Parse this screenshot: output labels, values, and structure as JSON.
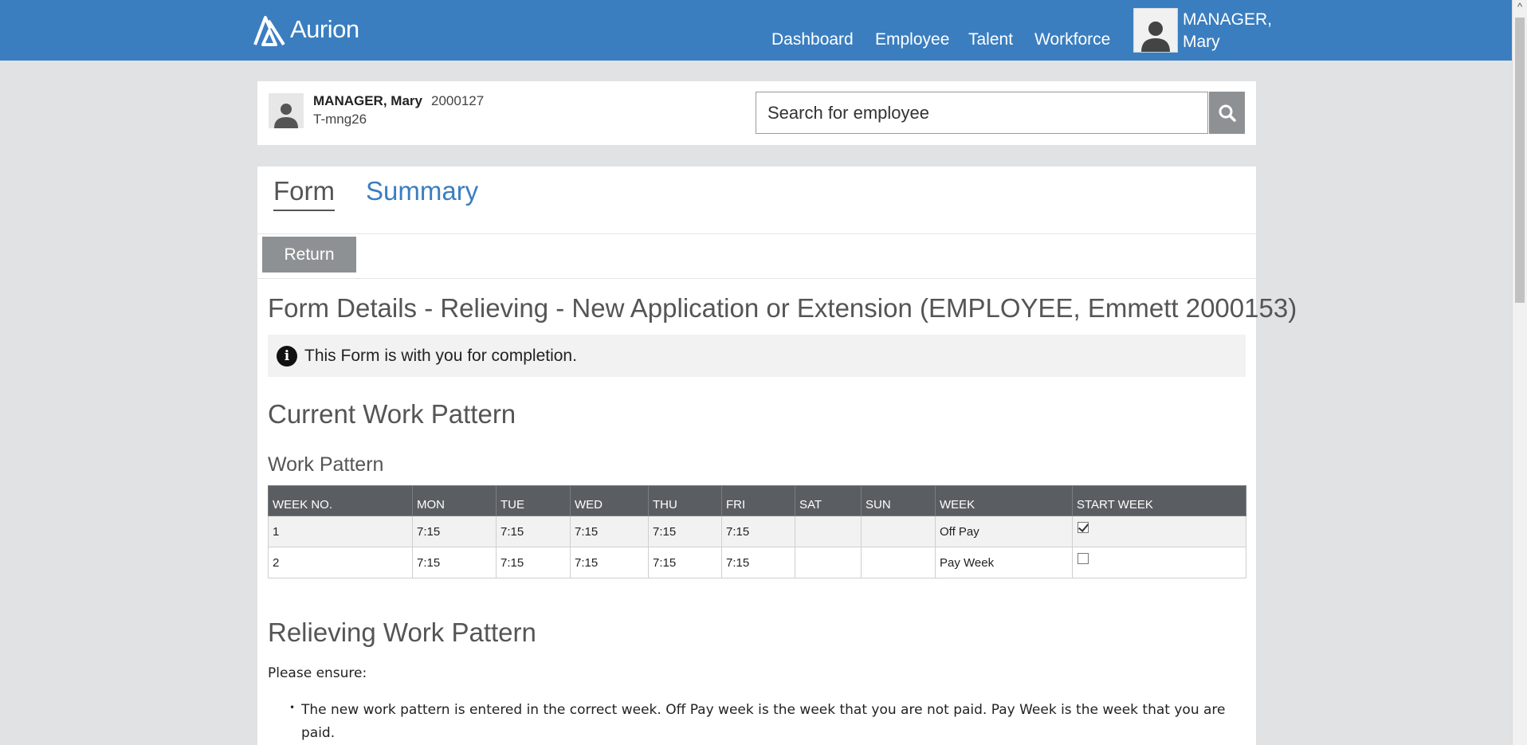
{
  "app": {
    "brand": "Aurion",
    "nav": [
      "Dashboard",
      "Employee",
      "Talent",
      "Workforce"
    ],
    "user": {
      "line1": "MANAGER,",
      "line2": "Mary"
    }
  },
  "employee": {
    "name": "MANAGER, Mary",
    "id": "2000127",
    "code": "T-mng26"
  },
  "search": {
    "placeholder": "Search for employee",
    "icon": "search-icon"
  },
  "tabs": [
    {
      "label": "Form",
      "active": true
    },
    {
      "label": "Summary",
      "active": false
    }
  ],
  "toolbar": {
    "return_label": "Return"
  },
  "form": {
    "title": "Form Details - Relieving - New Application or Extension (EMPLOYEE, Emmett 2000153)",
    "info": "This Form is with you for completion."
  },
  "current": {
    "heading": "Current Work Pattern",
    "subheading": "Work Pattern",
    "columns": [
      "WEEK NO.",
      "MON",
      "TUE",
      "WED",
      "THU",
      "FRI",
      "SAT",
      "SUN",
      "WEEK",
      "START WEEK"
    ],
    "rows": [
      {
        "week_no": "1",
        "mon": "7:15",
        "tue": "7:15",
        "wed": "7:15",
        "thu": "7:15",
        "fri": "7:15",
        "sat": "",
        "sun": "",
        "week": "Off Pay",
        "start_week": true
      },
      {
        "week_no": "2",
        "mon": "7:15",
        "tue": "7:15",
        "wed": "7:15",
        "thu": "7:15",
        "fri": "7:15",
        "sat": "",
        "sun": "",
        "week": "Pay Week",
        "start_week": false
      }
    ]
  },
  "relieving": {
    "heading": "Relieving Work Pattern",
    "ensure": "Please ensure:",
    "bullets": [
      "The new work pattern is entered in the correct week. Off Pay week is the week that you are not paid. Pay Week is the week that you are paid."
    ]
  },
  "colors": {
    "header": "#3a7ec0",
    "button": "#8e9193",
    "table_header": "#5a5e62"
  }
}
